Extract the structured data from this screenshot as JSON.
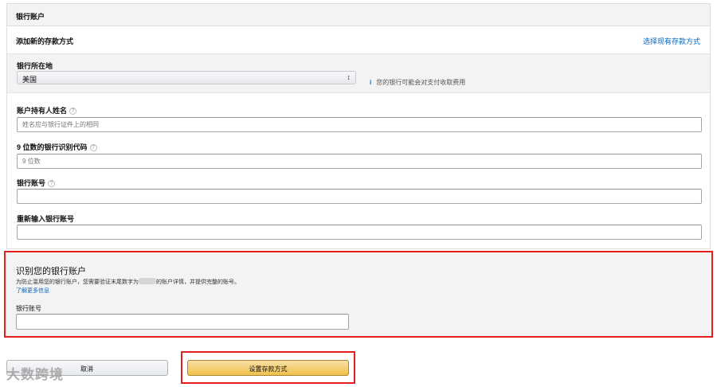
{
  "panel": {
    "header": "银行账户",
    "add_title": "添加新的存款方式",
    "choose_existing_link": "选择现有存款方式"
  },
  "country": {
    "label": "银行所在地",
    "selected": "美国",
    "info_icon": "info-icon",
    "info_text": "您的银行可能会对支付收取费用"
  },
  "fields": {
    "holder_name": {
      "label": "账户持有人姓名",
      "placeholder": "姓名应与银行证件上的相同",
      "value": ""
    },
    "routing": {
      "label": "9 位数的银行识别代码",
      "placeholder": "9 位数",
      "value": ""
    },
    "account": {
      "label": "银行账号",
      "placeholder": "",
      "value": ""
    },
    "account_confirm": {
      "label": "重新输入银行账号",
      "placeholder": "",
      "value": ""
    }
  },
  "identify": {
    "heading": "识别您的银行账户",
    "desc_before": "为防止滥用您的银行账户，您需要验证末尾数字为",
    "desc_after": "的账户详情，并提供完整的账号。",
    "learn_more": "了解更多信息",
    "account_label": "银行账号",
    "account_value": ""
  },
  "buttons": {
    "cancel": "取消",
    "submit": "设置存款方式"
  },
  "watermark": "大数跨境",
  "colors": {
    "link": "#0066c0",
    "highlight_border": "#e41e1e",
    "submit_top": "#f7dfa5",
    "submit_bottom": "#f0c14b"
  }
}
